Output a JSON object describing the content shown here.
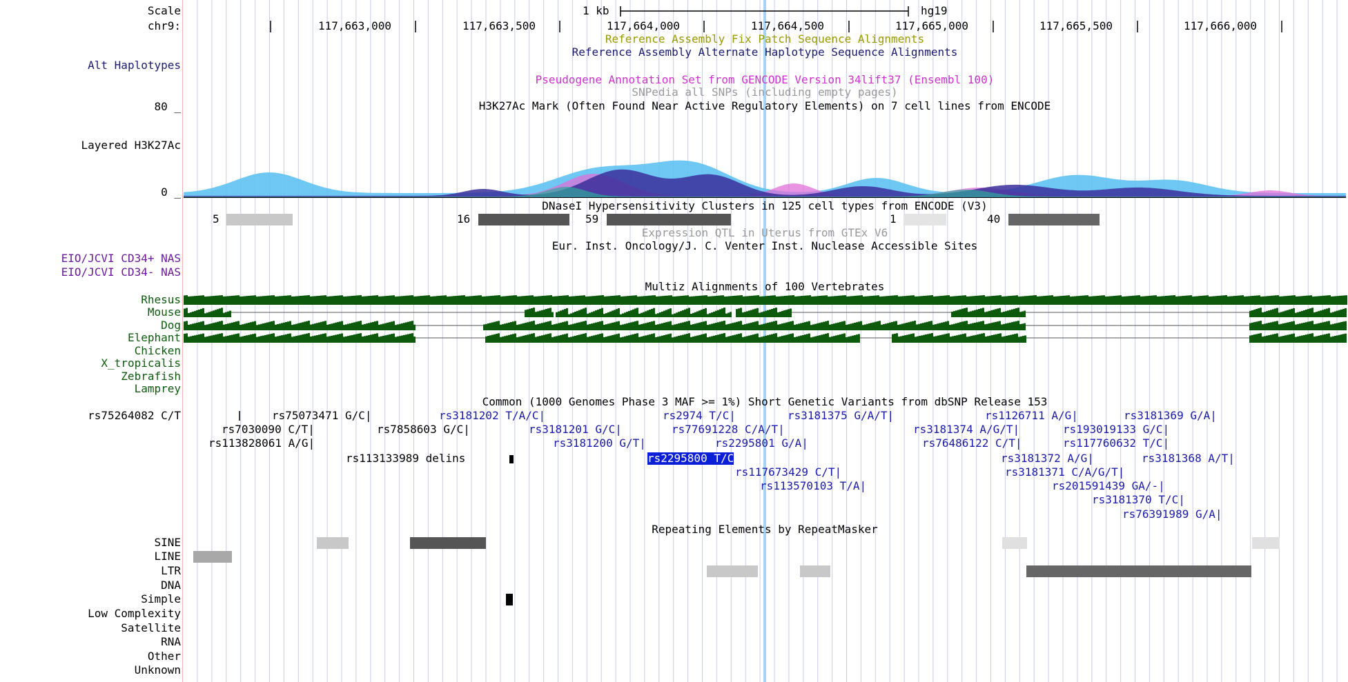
{
  "colors": {
    "label": "#000000",
    "snp_blue": "#1a1aa6",
    "snp_highlight_bg": "#0b1fd6",
    "multiz_green": "#0d5a0d",
    "alt_haplo_navy": "#1a1a6e",
    "fix_patch_olive": "#999900",
    "pseudogene_magenta": "#cc33cc",
    "gray_text": "#999999",
    "encode_purple": "#6a1a9a",
    "guide_line": "#c8cce8",
    "position_line": "#a9d3f5"
  },
  "ruler": {
    "scale_label": "Scale",
    "chrom_label": "chr9:",
    "scale_bar_text": "1 kb",
    "assembly": "hg19",
    "positions": [
      "117,663,000",
      "117,663,500",
      "117,664,000",
      "117,664,500",
      "117,665,000",
      "117,665,500",
      "117,666,000"
    ]
  },
  "tracks": {
    "fix_patch": "Reference Assembly Fix Patch Sequence Alignments",
    "alt_haplotypes_title": "Reference Assembly Alternate Haplotype Sequence Alignments",
    "alt_haplotypes_label": "Alt Haplotypes",
    "pseudogene": "Pseudogene Annotation Set from GENCODE Version 34lift37 (Ensembl 100)",
    "snpedia": "SNPedia all SNPs (including empty pages)",
    "h3k27ac_title": "H3K27Ac Mark (Often Found Near Active Regulatory Elements) on 7 cell lines from ENCODE",
    "h3k27ac_label": "Layered H3K27Ac",
    "h3k27ac_ymax": "80 _",
    "h3k27ac_ymin": "0 _",
    "dnase_title": "DNaseI Hypersensitivity Clusters in 125 cell types from ENCODE (V3)",
    "dnase_clusters": [
      {
        "score": "5",
        "shade": "#c8c8c8"
      },
      {
        "score": "16",
        "shade": "#555555"
      },
      {
        "score": "59",
        "shade": "#555555"
      },
      {
        "score": "1",
        "shade": "#e4e4e4"
      },
      {
        "score": "40",
        "shade": "#666666"
      }
    ],
    "eqtl": "Expression QTL in Uterus from GTEx V6",
    "nuclease": "Eur. Inst. Oncology/J. C. Venter Inst. Nuclease Accessible Sites",
    "eio_cd34_pos": "EIO/JCVI CD34+ NAS",
    "eio_cd34_neg": "EIO/JCVI CD34- NAS",
    "multiz_title": "Multiz Alignments of 100 Vertebrates",
    "multiz_species": [
      "Rhesus",
      "Mouse",
      "Dog",
      "Elephant",
      "Chicken",
      "X_tropicalis",
      "Zebrafish",
      "Lamprey"
    ],
    "snp_title": "Common (1000 Genomes Phase 3 MAF >= 1%) Short Genetic Variants from dbSNP Release 153",
    "snp_side_label": "rs75264082 C/T",
    "snps": [
      "rs75073471 G/C|",
      "rs3181202 T/A/C|",
      "rs2974 T/C|",
      "rs3181375 G/A/T|",
      "rs1126711 A/G|",
      "rs3181369 G/A|",
      "rs7030090 C/T|",
      "rs7858603 G/C|",
      "rs3181201 G/C|",
      "rs77691228 C/A/T|",
      "rs3181374 A/G/T|",
      "rs193019133 G/C|",
      "rs113828061 A/G|",
      "rs3181200 G/T|",
      "rs2295801 G/A|",
      "rs76486122 C/T|",
      "rs117760632 T/C|",
      "rs113133989 delins",
      "rs2295800 T/C",
      "rs3181372 A/G|",
      "rs3181368 A/T|",
      "rs117673429 C/T|",
      "rs3181371 C/A/G/T|",
      "rs113570103 T/A|",
      "rs201591439 GA/-|",
      "rs3181370 T/C|",
      "rs76391989 G/A|"
    ],
    "repeat_title": "Repeating Elements by RepeatMasker",
    "repeat_classes": [
      "SINE",
      "LINE",
      "LTR",
      "DNA",
      "Simple",
      "Low Complexity",
      "Satellite",
      "RNA",
      "Other",
      "Unknown"
    ]
  }
}
